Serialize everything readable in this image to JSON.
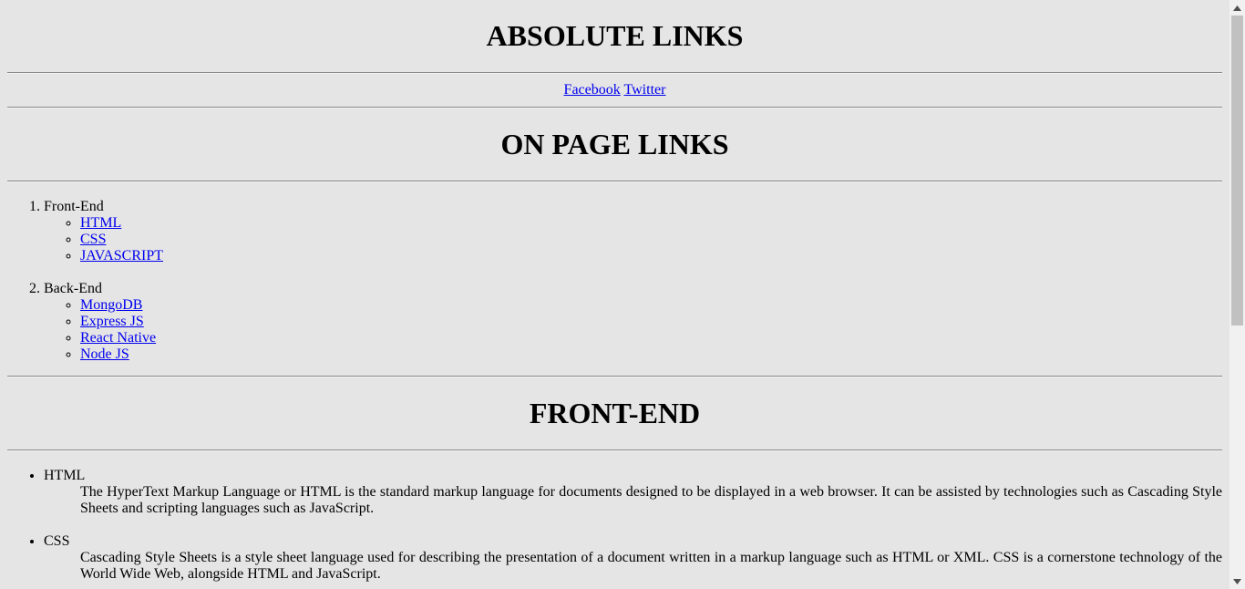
{
  "absolute": {
    "heading": "ABSOLUTE LINKS",
    "links": [
      "Facebook",
      "Twitter"
    ]
  },
  "onpage": {
    "heading": "ON PAGE LINKS",
    "groups": [
      {
        "label": "Front-End",
        "items": [
          "HTML",
          "CSS",
          "JAVASCRIPT"
        ]
      },
      {
        "label": "Back-End",
        "items": [
          "MongoDB",
          "Express JS",
          "React Native",
          "Node JS"
        ]
      }
    ]
  },
  "frontend": {
    "heading": "FRONT-END",
    "terms": [
      {
        "term": "HTML",
        "definition": "The HyperText Markup Language or HTML is the standard markup language for documents designed to be displayed in a web browser. It can be assisted by technologies such as Cascading Style Sheets and scripting languages such as JavaScript."
      },
      {
        "term": "CSS",
        "definition": "Cascading Style Sheets is a style sheet language used for describing the presentation of a document written in a markup language such as HTML or XML. CSS is a cornerstone technology of the World Wide Web, alongside HTML and JavaScript."
      }
    ]
  },
  "colors": {
    "background": "#e5e5e5",
    "link": "#0000ee",
    "scrollbar_track": "#f1f1f1",
    "scrollbar_thumb": "#c1c1c1"
  },
  "icons": {
    "scroll_up": "triangle-up-icon",
    "scroll_down": "triangle-down-icon"
  }
}
